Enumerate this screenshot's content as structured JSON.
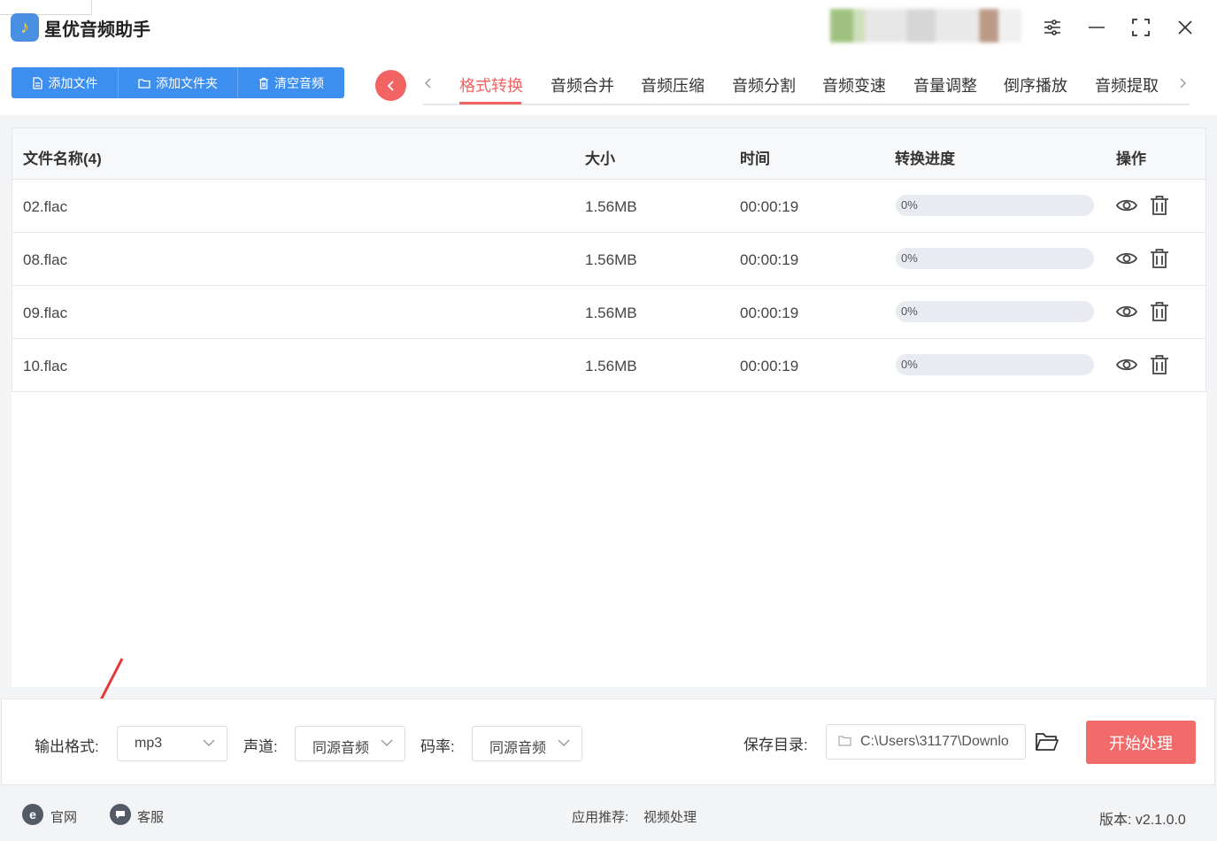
{
  "app": {
    "title": "星优音频助手",
    "logo_glyph": "♪"
  },
  "toolbar": {
    "add_file": "添加文件",
    "add_folder": "添加文件夹",
    "clear": "清空音频"
  },
  "tabs": [
    {
      "label": "格式转换",
      "active": true
    },
    {
      "label": "音频合并"
    },
    {
      "label": "音频压缩"
    },
    {
      "label": "音频分割"
    },
    {
      "label": "音频变速"
    },
    {
      "label": "音量调整"
    },
    {
      "label": "倒序播放"
    },
    {
      "label": "音频提取"
    }
  ],
  "table": {
    "headers": {
      "name": "文件名称(4)",
      "size": "大小",
      "time": "时间",
      "progress": "转换进度",
      "action": "操作"
    },
    "rows": [
      {
        "name": "02.flac",
        "size": "1.56MB",
        "time": "00:00:19",
        "progress": "0%",
        "progress_value": 0
      },
      {
        "name": "08.flac",
        "size": "1.56MB",
        "time": "00:00:19",
        "progress": "0%",
        "progress_value": 0
      },
      {
        "name": "09.flac",
        "size": "1.56MB",
        "time": "00:00:19",
        "progress": "0%",
        "progress_value": 0
      },
      {
        "name": "10.flac",
        "size": "1.56MB",
        "time": "00:00:19",
        "progress": "0%",
        "progress_value": 0
      }
    ]
  },
  "settings": {
    "format_label": "输出格式:",
    "format_value": "mp3",
    "channel_label": "声道:",
    "channel_value": "同源音频",
    "bitrate_label": "码率:",
    "bitrate_value": "同源音频",
    "save_label": "保存目录:",
    "save_path": "C:\\Users\\31177\\Downlo",
    "start_button": "开始处理"
  },
  "footer": {
    "website": "官网",
    "website_icon": "e",
    "service": "客服",
    "recommend": "应用推荐:",
    "recommend_link": "视频处理",
    "version": "版本: v2.1.0.0"
  },
  "colors": {
    "accent_blue": "#3d8fef",
    "accent_red": "#f26464"
  }
}
